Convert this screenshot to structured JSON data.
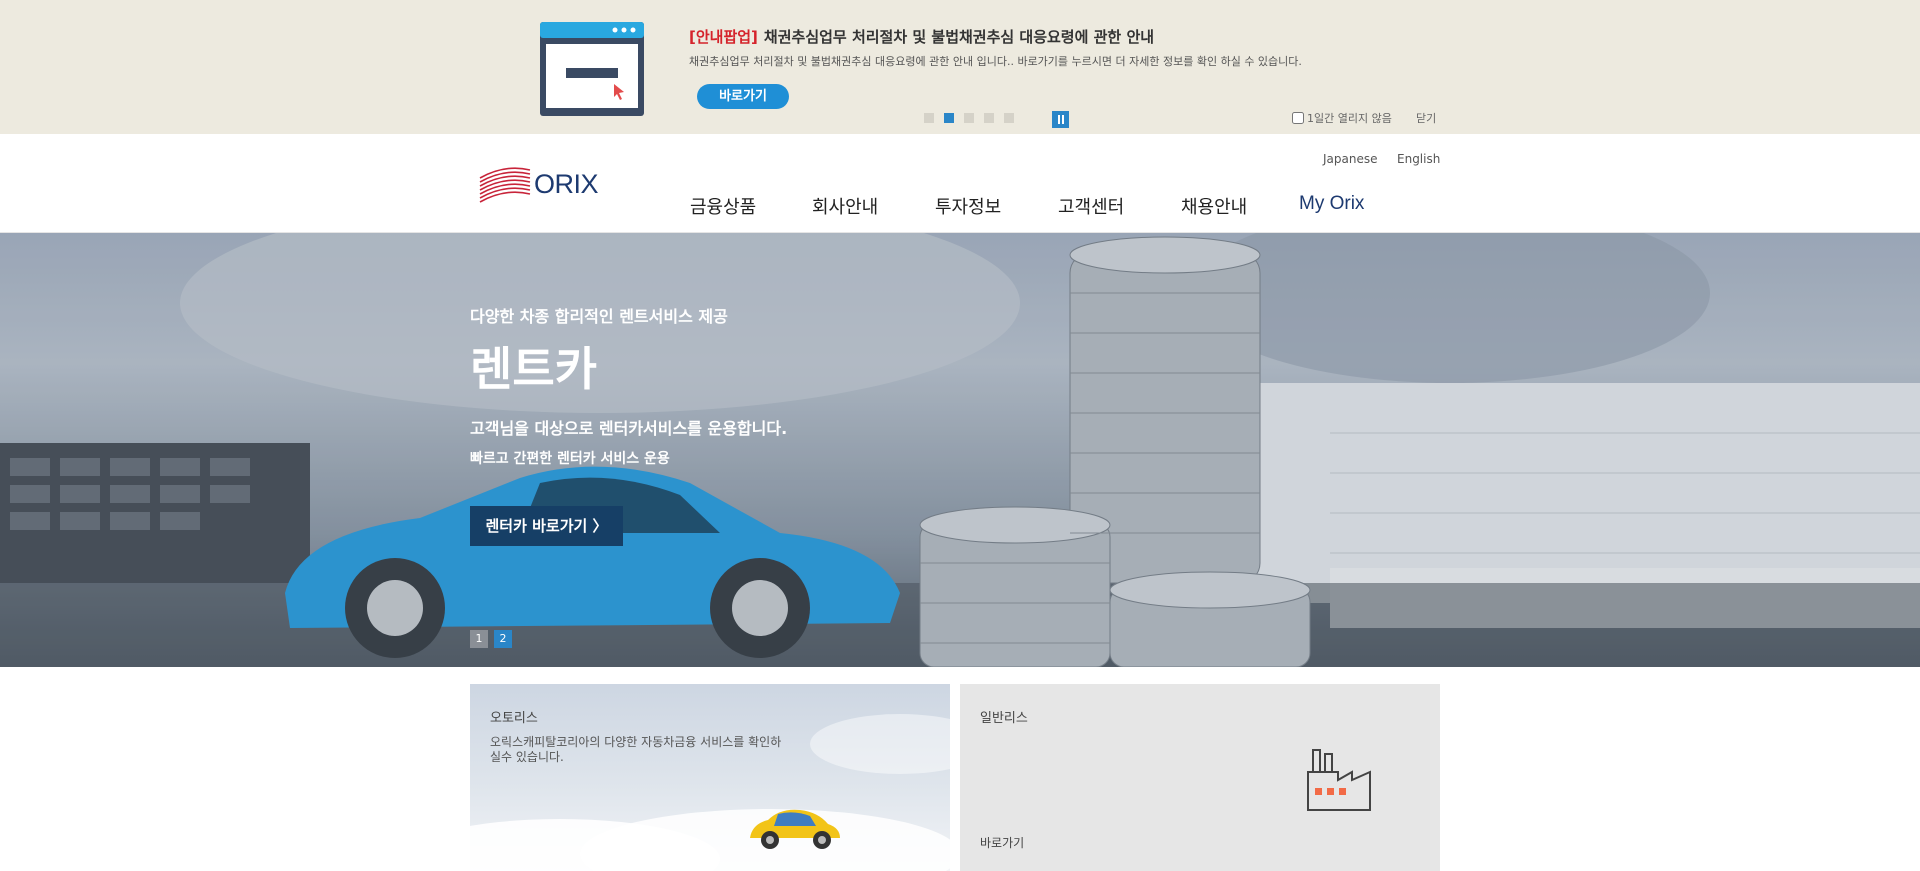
{
  "notice": {
    "tag": "[안내팝업]",
    "title": "채권추심업무 처리절차 및 불법채권추심 대응요령에 관한 안내",
    "description": "채권추심업무 처리절차 및 불법채권추심 대응요령에 관한 안내 입니다.. 바로가기를 누르시면 더 자세한 정보를 확인 하실 수 있습니다.",
    "button_label": "바로가기",
    "dots": 5,
    "active_dot": 2,
    "checkbox_label": "1일간 열리지 않음",
    "close_label": "닫기",
    "accent_color": "#2a86c8",
    "tag_color": "#d5232b"
  },
  "header": {
    "logo_text": "ORIX",
    "languages": [
      "Japanese",
      "English"
    ],
    "nav": [
      "금융상품",
      "회사안내",
      "투자정보",
      "고객센터",
      "채용안내",
      "My Orix"
    ]
  },
  "hero": {
    "eyebrow": "다양한 차종 합리적인 렌트서비스 제공",
    "title": "렌트카",
    "subtitle": "고객님을 대상으로 렌터카서비스를 운용합니다.",
    "subtitle2": "빠르고 간편한 렌터카 서비스 운용",
    "button_label": "렌터카 바로가기 〉",
    "pages": [
      "1",
      "2"
    ],
    "active_page": "2"
  },
  "cards": [
    {
      "title": "오토리스",
      "description": "오릭스캐피탈코리아의 다양한 자동차금융 서비스를 확인하실수 있습니다."
    },
    {
      "title": "일반리스",
      "link_label": "바로가기",
      "icon": "factory-icon"
    }
  ]
}
